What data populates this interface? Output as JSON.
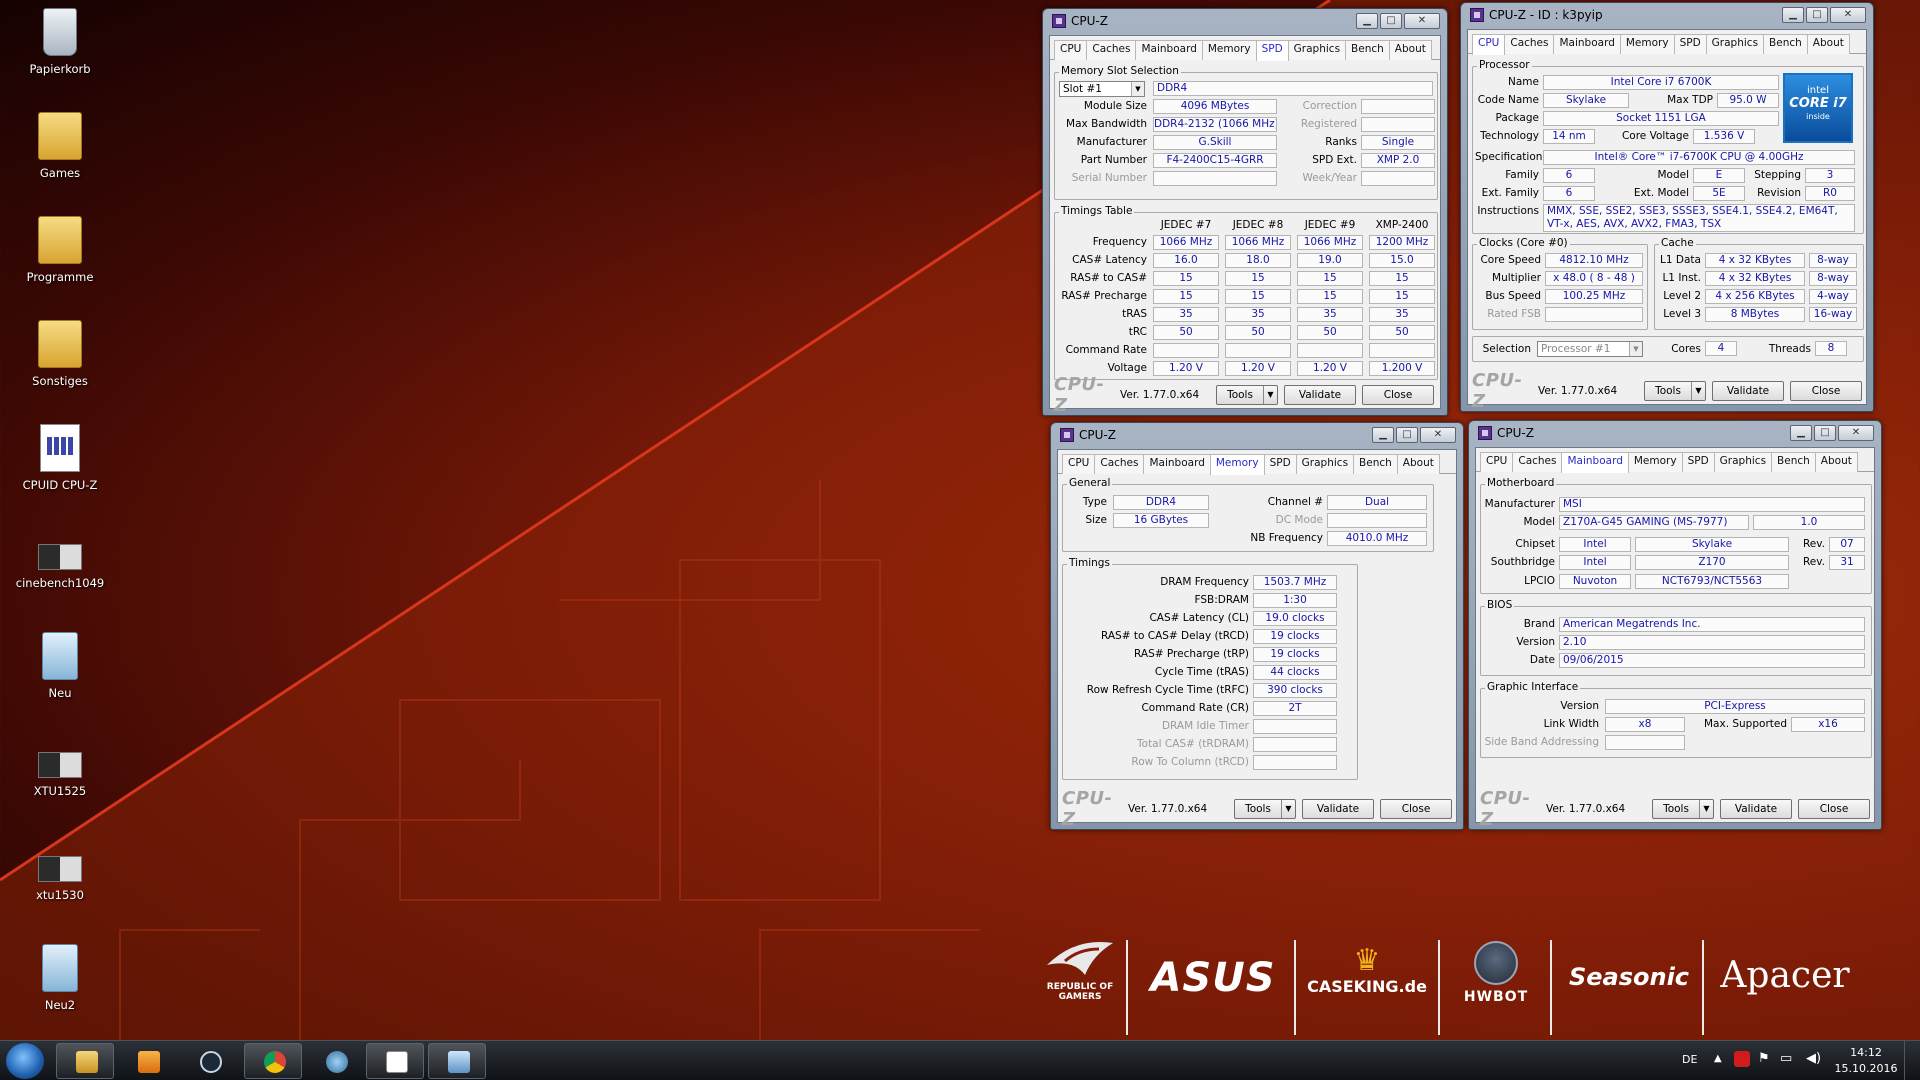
{
  "desktop": {
    "icons": [
      "Papierkorb",
      "Games",
      "Programme",
      "Sonstiges",
      "CPUID CPU-Z",
      "cinebench1049",
      "Neu",
      "XTU1525",
      "xtu1530",
      "Neu2"
    ]
  },
  "common": {
    "app_title": "CPU-Z",
    "brand": "CPU-Z",
    "version": "Ver. 1.77.0.x64",
    "tools": "Tools",
    "validate": "Validate",
    "close": "Close",
    "tabs": [
      "CPU",
      "Caches",
      "Mainboard",
      "Memory",
      "SPD",
      "Graphics",
      "Bench",
      "About"
    ]
  },
  "spd": {
    "slot_group": "Memory Slot Selection",
    "slot": "Slot #1",
    "type": "DDR4",
    "module_size_label": "Module Size",
    "module_size": "4096 MBytes",
    "bandwidth_label": "Max Bandwidth",
    "bandwidth": "DDR4-2132 (1066 MHz)",
    "manufacturer_label": "Manufacturer",
    "manufacturer": "G.Skill",
    "part_label": "Part Number",
    "part": "F4-2400C15-4GRR",
    "serial_label": "Serial Number",
    "correction_label": "Correction",
    "registered_label": "Registered",
    "ranks_label": "Ranks",
    "ranks": "Single",
    "spdext_label": "SPD Ext.",
    "spdext": "XMP 2.0",
    "week_label": "Week/Year",
    "timings_group": "Timings Table",
    "columns": [
      "JEDEC #7",
      "JEDEC #8",
      "JEDEC #9",
      "XMP-2400"
    ],
    "rows": [
      {
        "label": "Frequency",
        "values": [
          "1066 MHz",
          "1066 MHz",
          "1066 MHz",
          "1200 MHz"
        ]
      },
      {
        "label": "CAS# Latency",
        "values": [
          "16.0",
          "18.0",
          "19.0",
          "15.0"
        ]
      },
      {
        "label": "RAS# to CAS#",
        "values": [
          "15",
          "15",
          "15",
          "15"
        ]
      },
      {
        "label": "RAS# Precharge",
        "values": [
          "15",
          "15",
          "15",
          "15"
        ]
      },
      {
        "label": "tRAS",
        "values": [
          "35",
          "35",
          "35",
          "35"
        ]
      },
      {
        "label": "tRC",
        "values": [
          "50",
          "50",
          "50",
          "50"
        ]
      },
      {
        "label": "Command Rate",
        "values": [
          "",
          "",
          "",
          ""
        ]
      },
      {
        "label": "Voltage",
        "values": [
          "1.20 V",
          "1.20 V",
          "1.20 V",
          "1.200 V"
        ]
      }
    ]
  },
  "cpu": {
    "title": "CPU-Z - ID : k3pyip",
    "processor_group": "Processor",
    "name_label": "Name",
    "name": "Intel Core i7 6700K",
    "codename_label": "Code Name",
    "codename": "Skylake",
    "tdp_label": "Max TDP",
    "tdp": "95.0 W",
    "package_label": "Package",
    "package": "Socket 1151 LGA",
    "tech_label": "Technology",
    "tech": "14 nm",
    "corev_label": "Core Voltage",
    "corev": "1.536 V",
    "spec_label": "Specification",
    "spec": "Intel® Core™ i7-6700K CPU @ 4.00GHz",
    "family_label": "Family",
    "family": "6",
    "model_label": "Model",
    "model": "E",
    "stepping_label": "Stepping",
    "stepping": "3",
    "extfamily_label": "Ext. Family",
    "extfamily": "6",
    "extmodel_label": "Ext. Model",
    "extmodel": "5E",
    "revision_label": "Revision",
    "revision": "R0",
    "instr_label": "Instructions",
    "instr": "MMX, SSE, SSE2, SSE3, SSSE3, SSE4.1, SSE4.2, EM64T, VT-x, AES, AVX, AVX2, FMA3, TSX",
    "logo_top": "intel",
    "logo_mid": "CORE i7",
    "logo_bottom": "inside",
    "clocks_group": "Clocks (Core #0)",
    "corespeed_label": "Core Speed",
    "corespeed": "4812.10 MHz",
    "mult_label": "Multiplier",
    "mult": "x 48.0 ( 8 - 48 )",
    "bus_label": "Bus Speed",
    "bus": "100.25 MHz",
    "fsb_label": "Rated FSB",
    "cache_group": "Cache",
    "l1d_label": "L1 Data",
    "l1d": "4 x 32 KBytes",
    "l1d_way": "8-way",
    "l1i_label": "L1 Inst.",
    "l1i": "4 x 32 KBytes",
    "l1i_way": "8-way",
    "l2_label": "Level 2",
    "l2": "4 x 256 KBytes",
    "l2_way": "4-way",
    "l3_label": "Level 3",
    "l3": "8 MBytes",
    "l3_way": "16-way",
    "selection_label": "Selection",
    "selection": "Processor #1",
    "cores_label": "Cores",
    "cores": "4",
    "threads_label": "Threads",
    "threads": "8"
  },
  "memory": {
    "general_group": "General",
    "type_label": "Type",
    "type": "DDR4",
    "size_label": "Size",
    "size": "16 GBytes",
    "channel_label": "Channel #",
    "channel": "Dual",
    "dcmode_label": "DC Mode",
    "nb_label": "NB Frequency",
    "nb": "4010.0 MHz",
    "timings_group": "Timings",
    "rows": [
      {
        "label": "DRAM Frequency",
        "value": "1503.7 MHz",
        "dim": false
      },
      {
        "label": "FSB:DRAM",
        "value": "1:30",
        "dim": false
      },
      {
        "label": "CAS# Latency (CL)",
        "value": "19.0 clocks",
        "dim": false
      },
      {
        "label": "RAS# to CAS# Delay (tRCD)",
        "value": "19 clocks",
        "dim": false
      },
      {
        "label": "RAS# Precharge (tRP)",
        "value": "19 clocks",
        "dim": false
      },
      {
        "label": "Cycle Time (tRAS)",
        "value": "44 clocks",
        "dim": false
      },
      {
        "label": "Row Refresh Cycle Time (tRFC)",
        "value": "390 clocks",
        "dim": false
      },
      {
        "label": "Command Rate (CR)",
        "value": "2T",
        "dim": false
      },
      {
        "label": "DRAM Idle Timer",
        "value": "",
        "dim": true
      },
      {
        "label": "Total CAS# (tRDRAM)",
        "value": "",
        "dim": true
      },
      {
        "label": "Row To Column (tRCD)",
        "value": "",
        "dim": true
      }
    ]
  },
  "mainboard": {
    "mb_group": "Motherboard",
    "manufacturer_label": "Manufacturer",
    "manufacturer": "MSI",
    "model_label": "Model",
    "model": "Z170A-G45 GAMING (MS-7977)",
    "model_rev": "1.0",
    "chipset_label": "Chipset",
    "chipset_vendor": "Intel",
    "chipset": "Skylake",
    "rev_label": "Rev.",
    "chipset_rev": "07",
    "south_label": "Southbridge",
    "south_vendor": "Intel",
    "south": "Z170",
    "south_rev": "31",
    "lpcio_label": "LPCIO",
    "lpcio_vendor": "Nuvoton",
    "lpcio": "NCT6793/NCT5563",
    "bios_group": "BIOS",
    "brand_label": "Brand",
    "brand": "American Megatrends Inc.",
    "version_label": "Version",
    "version": "2.10",
    "date_label": "Date",
    "date": "09/06/2015",
    "gi_group": "Graphic Interface",
    "giversion_label": "Version",
    "giversion": "PCI-Express",
    "link_label": "Link Width",
    "link": "x8",
    "maxsup_label": "Max. Supported",
    "maxsup": "x16",
    "sideband_label": "Side Band Addressing"
  },
  "sponsors": [
    "REPUBLIC OF GAMERS",
    "ASUS",
    "CASEKING.de",
    "HWBOT",
    "Seasonic",
    "Apacer"
  ],
  "taskbar": {
    "lang": "DE",
    "time": "14:12",
    "date": "15.10.2016"
  }
}
